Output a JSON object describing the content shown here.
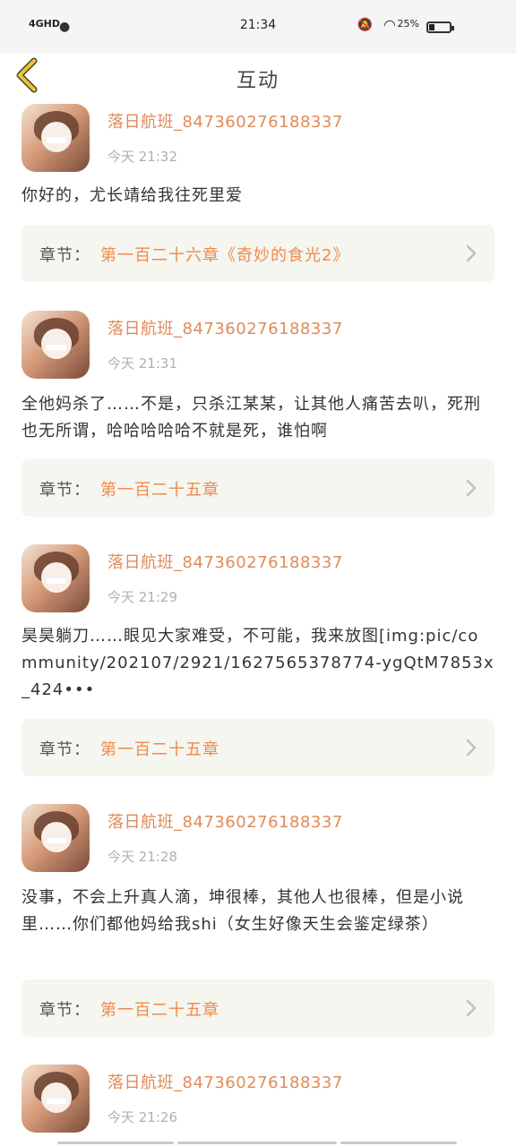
{
  "status_bar": {
    "network": "4GHD",
    "time": "21:34",
    "battery": "25%"
  },
  "header": {
    "title": "互动"
  },
  "chapter_label": "章节：",
  "comments": [
    {
      "username": "落日航班_847360276188337",
      "time": "今天 21:32",
      "content": "你好的，尤长靖给我往死里爱",
      "chapter": "第一百二十六章《奇妙的食光2》"
    },
    {
      "username": "落日航班_847360276188337",
      "time": "今天 21:31",
      "content": "全他妈杀了……不是，只杀江某某，让其他人痛苦去叭，死刑也无所谓，哈哈哈哈哈不就是死，谁怕啊",
      "chapter": "第一百二十五章"
    },
    {
      "username": "落日航班_847360276188337",
      "time": "今天 21:29",
      "content": "昊昊躺刀……眼见大家难受，不可能，我来放图[img:pic/community/202107/2921/1627565378774-ygQtM7853x_424•••",
      "chapter": "第一百二十五章"
    },
    {
      "username": "落日航班_847360276188337",
      "time": "今天 21:28",
      "content": "没事，不会上升真人滴，坤很棒，其他人也很棒，但是小说里……你们都他妈给我shi（女生好像天生会鉴定绿茶）",
      "chapter": "第一百二十五章"
    },
    {
      "username": "落日航班_847360276188337",
      "time": "今天 21:26"
    }
  ]
}
